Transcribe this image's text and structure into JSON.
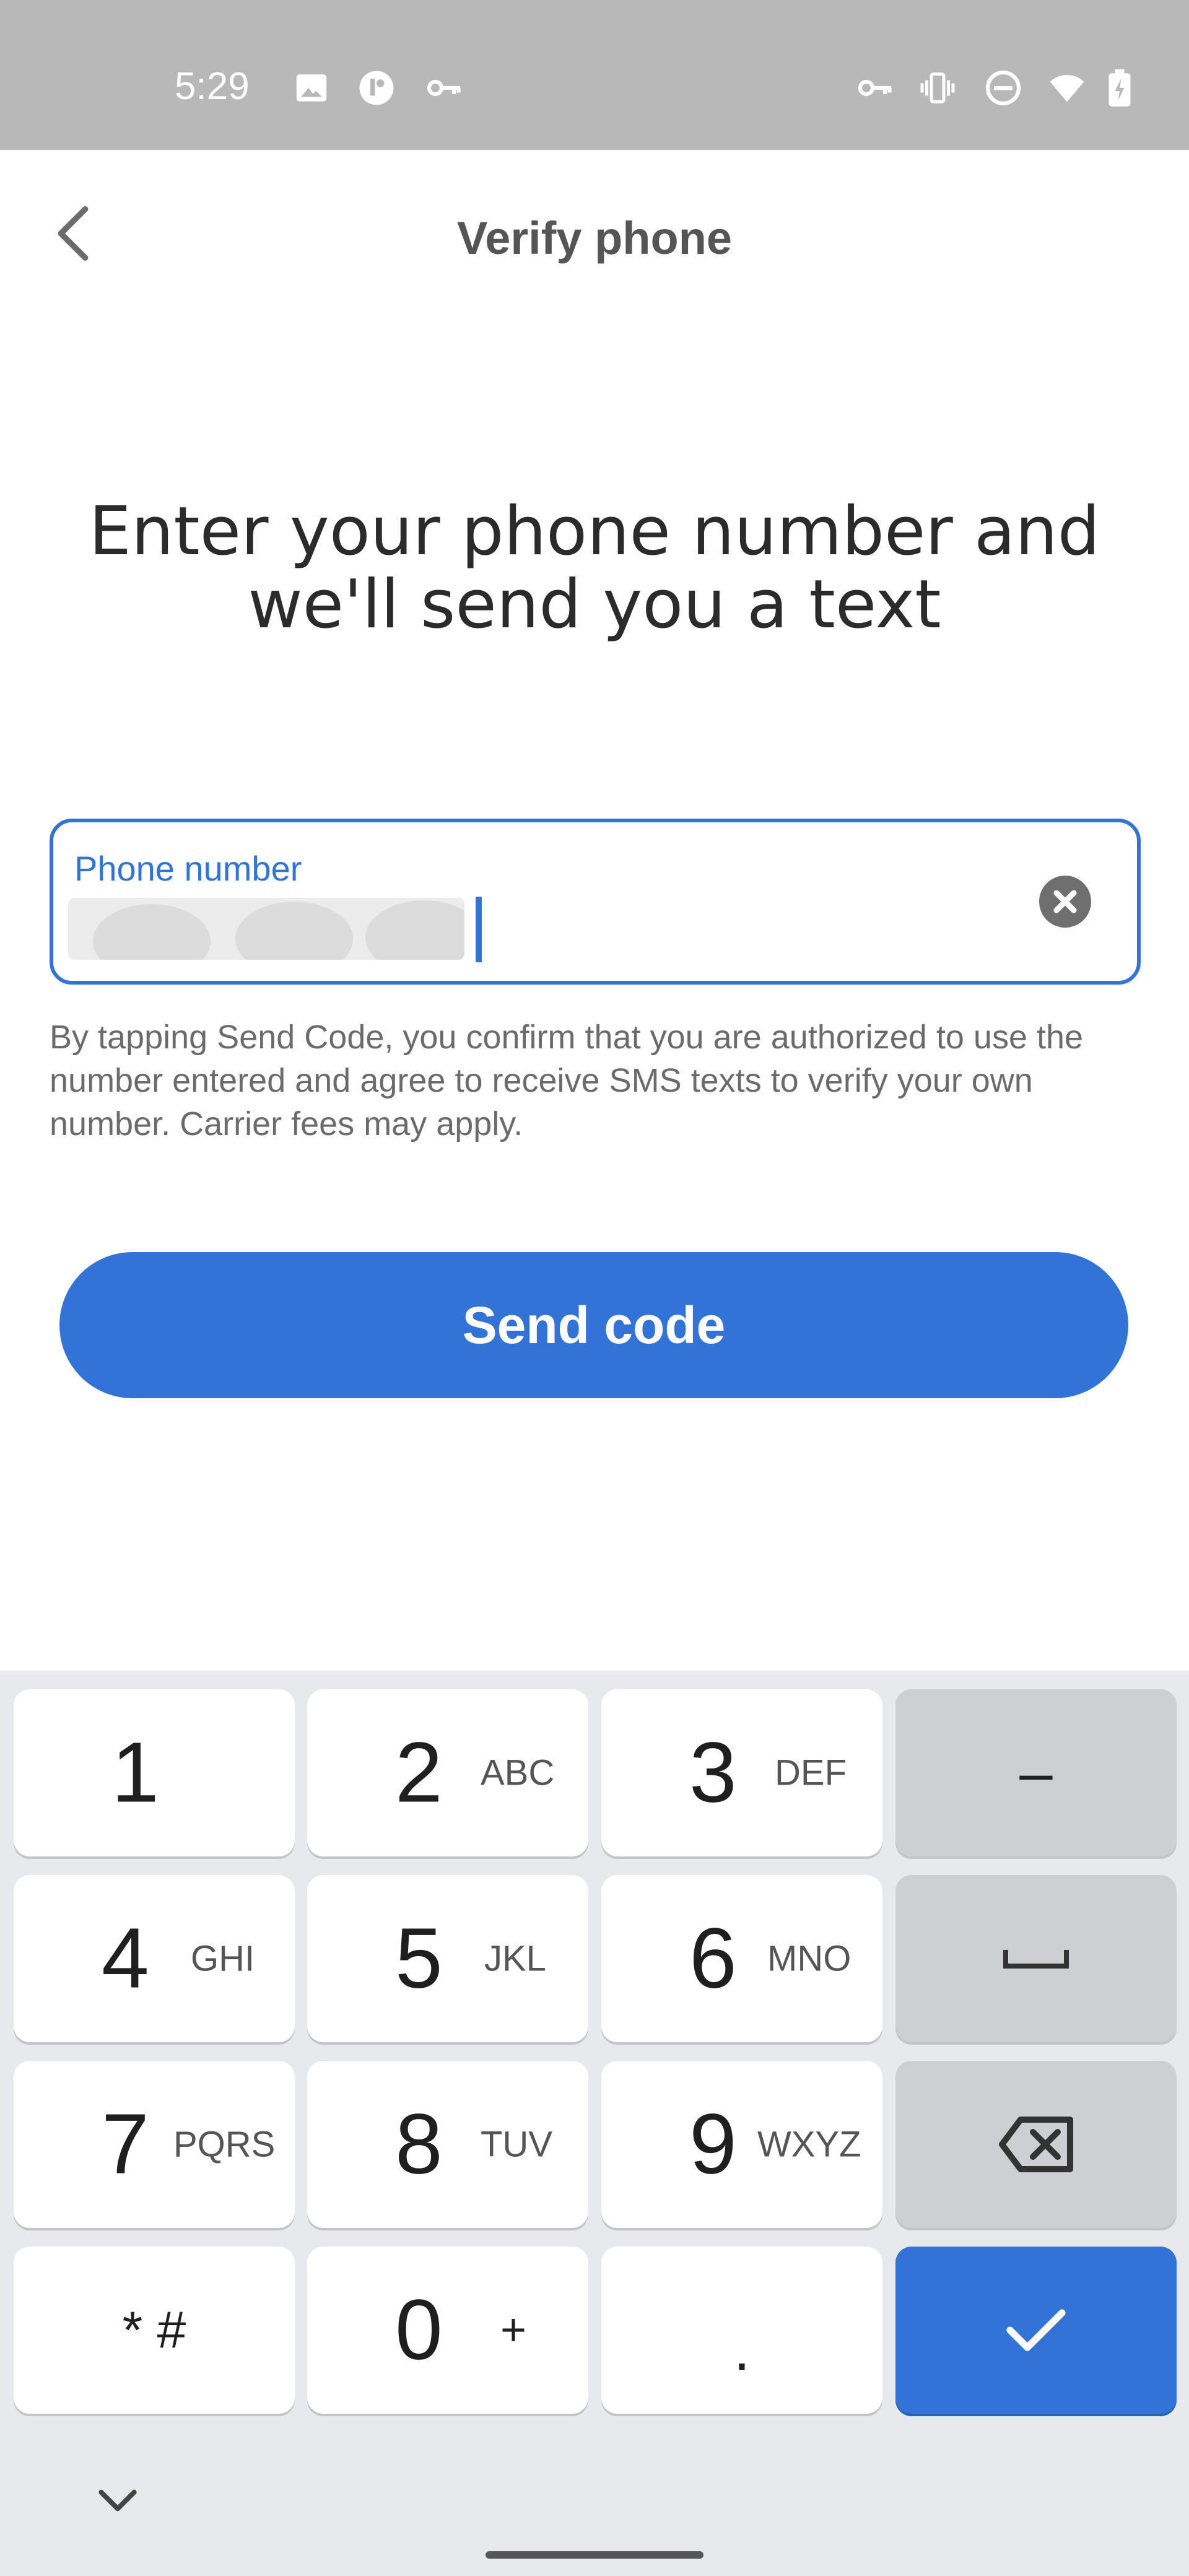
{
  "status_bar": {
    "time": "5:29",
    "left_icons": [
      "image-icon",
      "app-notification-icon",
      "key-icon"
    ],
    "right_icons": [
      "vpn-key-icon",
      "vibrate-icon",
      "do-not-disturb-icon",
      "wifi-icon",
      "battery-charging-icon"
    ]
  },
  "app_bar": {
    "back_icon": "chevron-left-icon",
    "title": "Verify phone"
  },
  "heading": "Enter your phone number and we'll send you a text",
  "phone_input": {
    "label": "Phone number",
    "value": "",
    "clear_icon": "clear-circle-icon"
  },
  "disclaimer": "By tapping Send Code, you confirm that you are authorized to use the number entered and agree to receive SMS texts to verify your own number. Carrier fees may apply.",
  "send_button": "Send code",
  "keyboard": {
    "keys": [
      {
        "digit": "1",
        "letters": ""
      },
      {
        "digit": "2",
        "letters": "ABC"
      },
      {
        "digit": "3",
        "letters": "DEF"
      },
      {
        "digit": "4",
        "letters": "GHI"
      },
      {
        "digit": "5",
        "letters": "JKL"
      },
      {
        "digit": "6",
        "letters": "MNO"
      },
      {
        "digit": "7",
        "letters": "PQRS"
      },
      {
        "digit": "8",
        "letters": "TUV"
      },
      {
        "digit": "9",
        "letters": "WXYZ"
      },
      {
        "digit": "* #",
        "letters": ""
      },
      {
        "digit": "0",
        "letters": "+"
      },
      {
        "digit": ".",
        "letters": ""
      }
    ],
    "dash_key": "–",
    "space_icon": "space-bar-icon",
    "backspace_icon": "backspace-icon",
    "enter_icon": "checkmark-icon",
    "collapse_icon": "chevron-down-icon",
    "accent_color": "#3173d6"
  }
}
